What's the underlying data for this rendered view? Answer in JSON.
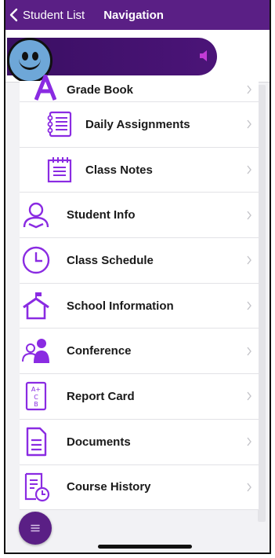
{
  "nav": {
    "back_label": "Student List",
    "title": "Navigation"
  },
  "banner": {
    "speaker_icon": "speaker-icon",
    "avatar_icon": "smiley-avatar-icon"
  },
  "colors": {
    "brand_purple": "#5a1f85",
    "icon_purple": "#8a2be2",
    "banner_dark": "#3a0f63"
  },
  "menu": {
    "items": [
      {
        "label": "Grade Book",
        "icon": "grade-book-icon"
      },
      {
        "label": "Daily Assignments",
        "icon": "daily-assignments-icon"
      },
      {
        "label": "Class Notes",
        "icon": "class-notes-icon"
      },
      {
        "label": "Student Info",
        "icon": "student-info-icon"
      },
      {
        "label": "Class Schedule",
        "icon": "clock-icon"
      },
      {
        "label": "School Information",
        "icon": "school-house-icon"
      },
      {
        "label": "Conference",
        "icon": "conference-icon"
      },
      {
        "label": "Report Card",
        "icon": "report-card-icon"
      },
      {
        "label": "Documents",
        "icon": "document-icon"
      },
      {
        "label": "Course History",
        "icon": "course-history-icon"
      }
    ]
  },
  "fab": {
    "icon": "menu-icon"
  }
}
